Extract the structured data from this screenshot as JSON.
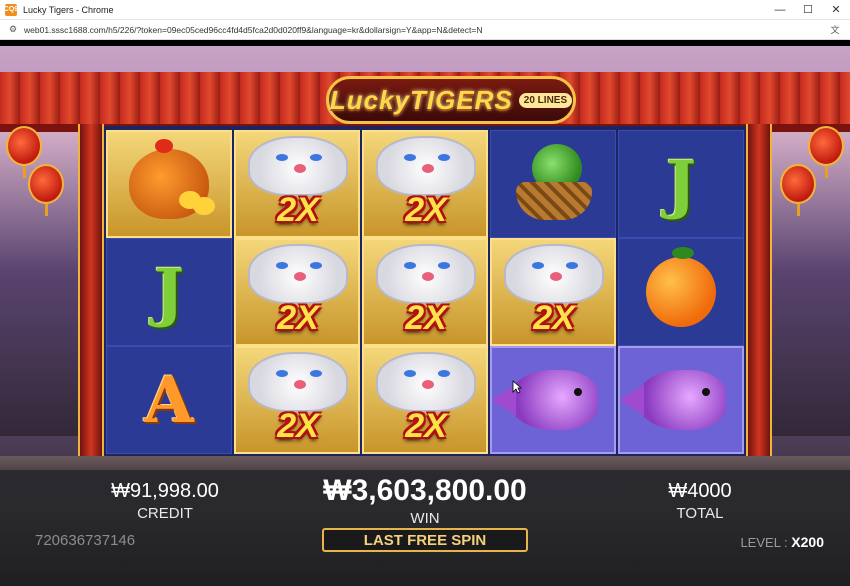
{
  "window": {
    "title": "Lucky Tigers - Chrome",
    "app_icon_text": "CQ9",
    "url": "web01.sssc1688.com/h5/226/?token=09ec05ced96cc4fd4d5fca2d0d020ff9&language=kr&dollarsign=Y&app=N&detect=N",
    "controls": {
      "minimize": "—",
      "maximize": "☐",
      "close": "✕"
    }
  },
  "game": {
    "logo": {
      "name": "LuckyTIGERS",
      "lines": "20 LINES"
    },
    "reels": [
      [
        "hen",
        "J",
        "A"
      ],
      [
        "tiger-2x",
        "tiger-2x",
        "tiger-2x"
      ],
      [
        "tiger-2x",
        "tiger-2x",
        "tiger-2x"
      ],
      [
        "cabbage-basket",
        "tiger-2x",
        "koi"
      ],
      [
        "J",
        "orange",
        "koi"
      ]
    ],
    "multiplier_text": "2X",
    "letters": {
      "j": "J",
      "a": "A"
    }
  },
  "hud": {
    "credit_value": "₩91,998.00",
    "credit_label": "CREDIT",
    "win_value": "₩3,603,800.00",
    "win_label": "WIN",
    "total_value": "₩4000",
    "total_label": "TOTAL",
    "ticket_id": "720636737146",
    "last_free_spin": "LAST FREE SPIN",
    "level_label": "LEVEL :",
    "level_value": "X200"
  },
  "colors": {
    "accent_gold": "#e6b64a",
    "reel_bg": "#2b3a94",
    "multiplier": "#ffe24a"
  }
}
